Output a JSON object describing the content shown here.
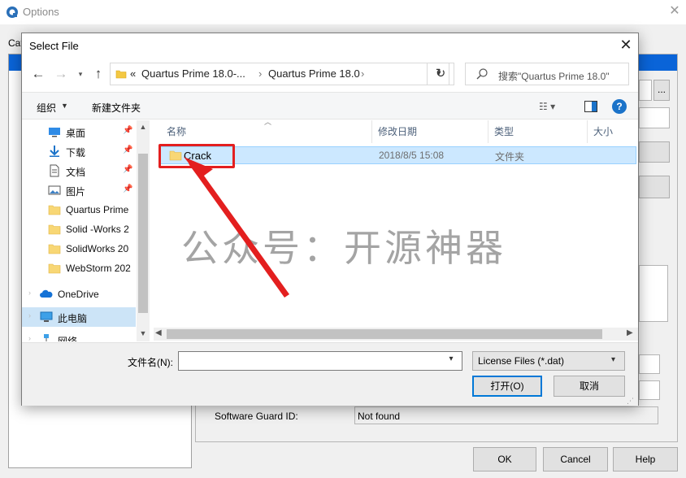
{
  "options_window": {
    "title": "Options",
    "category_label": "Cat",
    "guard_id_label": "Software Guard ID:",
    "guard_id_value": "Not found",
    "buttons": {
      "ok": "OK",
      "cancel": "Cancel",
      "help": "Help"
    },
    "browse_button": "..."
  },
  "dialog": {
    "title": "Select File",
    "breadcrumb": [
      "«",
      "Quartus Prime 18.0-...",
      "›",
      "Quartus Prime 18.0",
      "›"
    ],
    "search_placeholder": "搜索\"Quartus Prime 18.0\"",
    "toolbar": {
      "organize": "组织",
      "new_folder": "新建文件夹"
    },
    "nav_items": [
      {
        "label": "桌面",
        "icon": "desktop-icon",
        "pinned": true
      },
      {
        "label": "下载",
        "icon": "download-icon",
        "pinned": true
      },
      {
        "label": "文档",
        "icon": "document-icon",
        "pinned": true
      },
      {
        "label": "图片",
        "icon": "pictures-icon",
        "pinned": true
      },
      {
        "label": "Quartus Prime",
        "icon": "folder-icon",
        "pinned": false
      },
      {
        "label": "Solid -Works 2",
        "icon": "folder-icon",
        "pinned": false
      },
      {
        "label": "SolidWorks 20",
        "icon": "folder-icon",
        "pinned": false
      },
      {
        "label": "WebStorm 202",
        "icon": "folder-icon",
        "pinned": false
      },
      {
        "label": "OneDrive",
        "icon": "onedrive-icon",
        "pinned": false
      },
      {
        "label": "此电脑",
        "icon": "this-pc-icon",
        "pinned": false,
        "selected": true
      },
      {
        "label": "网络",
        "icon": "network-icon",
        "pinned": false
      }
    ],
    "columns": {
      "name": "名称",
      "modified": "修改日期",
      "type": "类型",
      "size": "大小"
    },
    "files": [
      {
        "name": "Crack",
        "modified": "2018/8/5 15:08",
        "type": "文件夹",
        "selected": true
      }
    ],
    "filename_label": "文件名(N):",
    "filename_value": "",
    "filter": "License Files (*.dat)",
    "open_button": "打开(O)",
    "cancel_button": "取消"
  },
  "watermark": "公众号：开源神器",
  "colors": {
    "accent": "#0078d7",
    "selection": "#cce8ff",
    "annotation_red": "#e31f1f"
  }
}
